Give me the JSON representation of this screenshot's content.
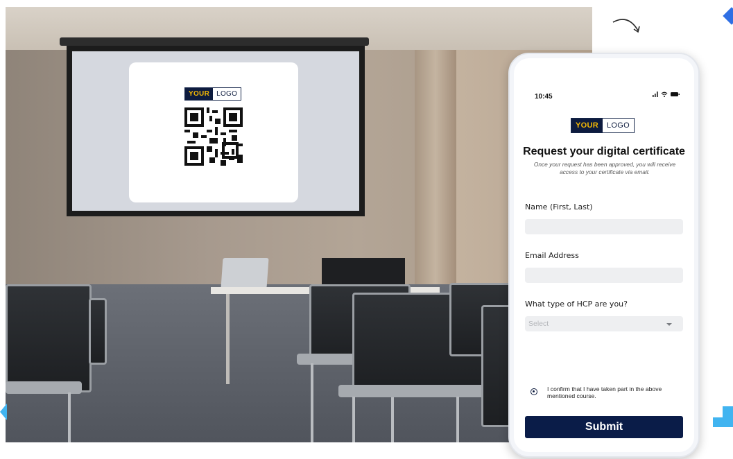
{
  "screen_logo": {
    "part1": "YOUR",
    "part2": "LOGO"
  },
  "phone": {
    "status_time": "10:45",
    "logo": {
      "part1": "YOUR",
      "part2": "LOGO"
    },
    "title": "Request your digital certificate",
    "subtitle": "Once your request has been approved, you will receive access to your certificate via email.",
    "fields": {
      "name_label": "Name (First, Last)",
      "name_value": "",
      "email_label": "Email Address",
      "email_value": "",
      "hcp_label": "What type of HCP are you?",
      "hcp_selected": "Select"
    },
    "confirm_text": "I confirm that I have taken part in the above mentioned course.",
    "submit_label": "Submit"
  },
  "colors": {
    "brand_navy": "#0a1c48",
    "logo_yellow": "#f2b705",
    "accent_blue": "#2f6fe4",
    "accent_light_blue": "#41b4f0"
  },
  "icons": [
    "signal-icon",
    "wifi-icon",
    "battery-icon",
    "dropdown-caret-icon",
    "curved-arrow-icon",
    "qr-code-icon"
  ]
}
